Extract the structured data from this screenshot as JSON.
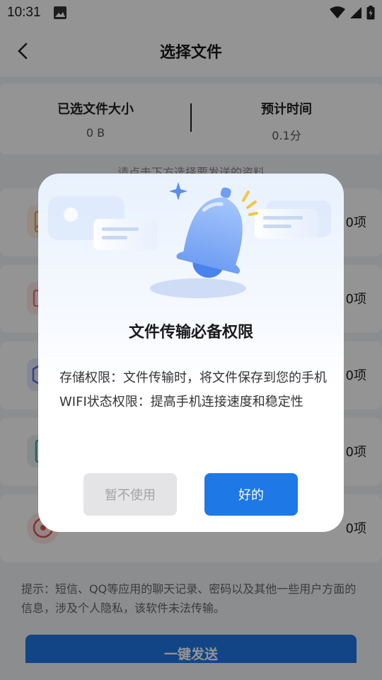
{
  "status_bar": {
    "time": "10:31"
  },
  "header": {
    "title": "选择文件"
  },
  "summary": {
    "size_label": "已选文件大小",
    "size_value": "0 B",
    "time_label": "预计时间",
    "time_value": "0.1分"
  },
  "hint_top": "请点击下方选择要发送的资料",
  "categories": [
    {
      "icon": "image-icon",
      "count": "0项",
      "color": "#f0a15c"
    },
    {
      "icon": "video-icon",
      "count": "0项",
      "color": "#ee7a74"
    },
    {
      "icon": "app-icon",
      "count": "0项",
      "color": "#5b74e6"
    },
    {
      "icon": "document-icon",
      "count": "0项",
      "color": "#4aa6a0"
    },
    {
      "icon": "music-icon",
      "count": "0项",
      "color": "#e5534f"
    }
  ],
  "bottom_hint": "提示：短信、QQ等应用的聊天记录、密码以及其他一些用户方面的信息，涉及个人隐私，该软件未法传输。",
  "send_button": "一键发送",
  "dialog": {
    "title": "文件传输必备权限",
    "line1": "存储权限：文件传输时，将文件保存到您的手机",
    "line2": "WIFI状态权限：提高手机连接速度和稳定性",
    "decline": "暂不使用",
    "accept": "好的"
  }
}
